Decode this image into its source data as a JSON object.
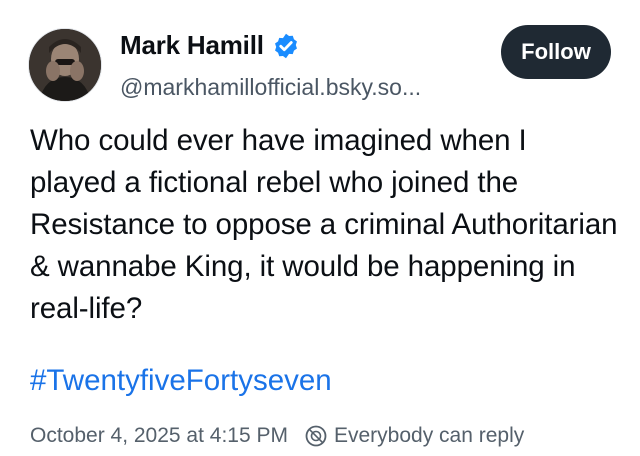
{
  "author": {
    "name": "Mark Hamill",
    "handle": "@markhamillofficial.bsky.so...",
    "verified_color": "#1a8cff"
  },
  "follow_label": "Follow",
  "post": {
    "text": "Who could ever have imagined when I played a fictional rebel who joined the Resistance to oppose a criminal Authoritarian & wannabe King, it would be happening in real-life?",
    "hashtag": "#TwentyfiveFortyseven",
    "timestamp": "October 4, 2025 at 4:15 PM",
    "reply_setting": "Everybody can reply"
  },
  "colors": {
    "link": "#1a73e8",
    "follow_bg": "#1f2933"
  }
}
